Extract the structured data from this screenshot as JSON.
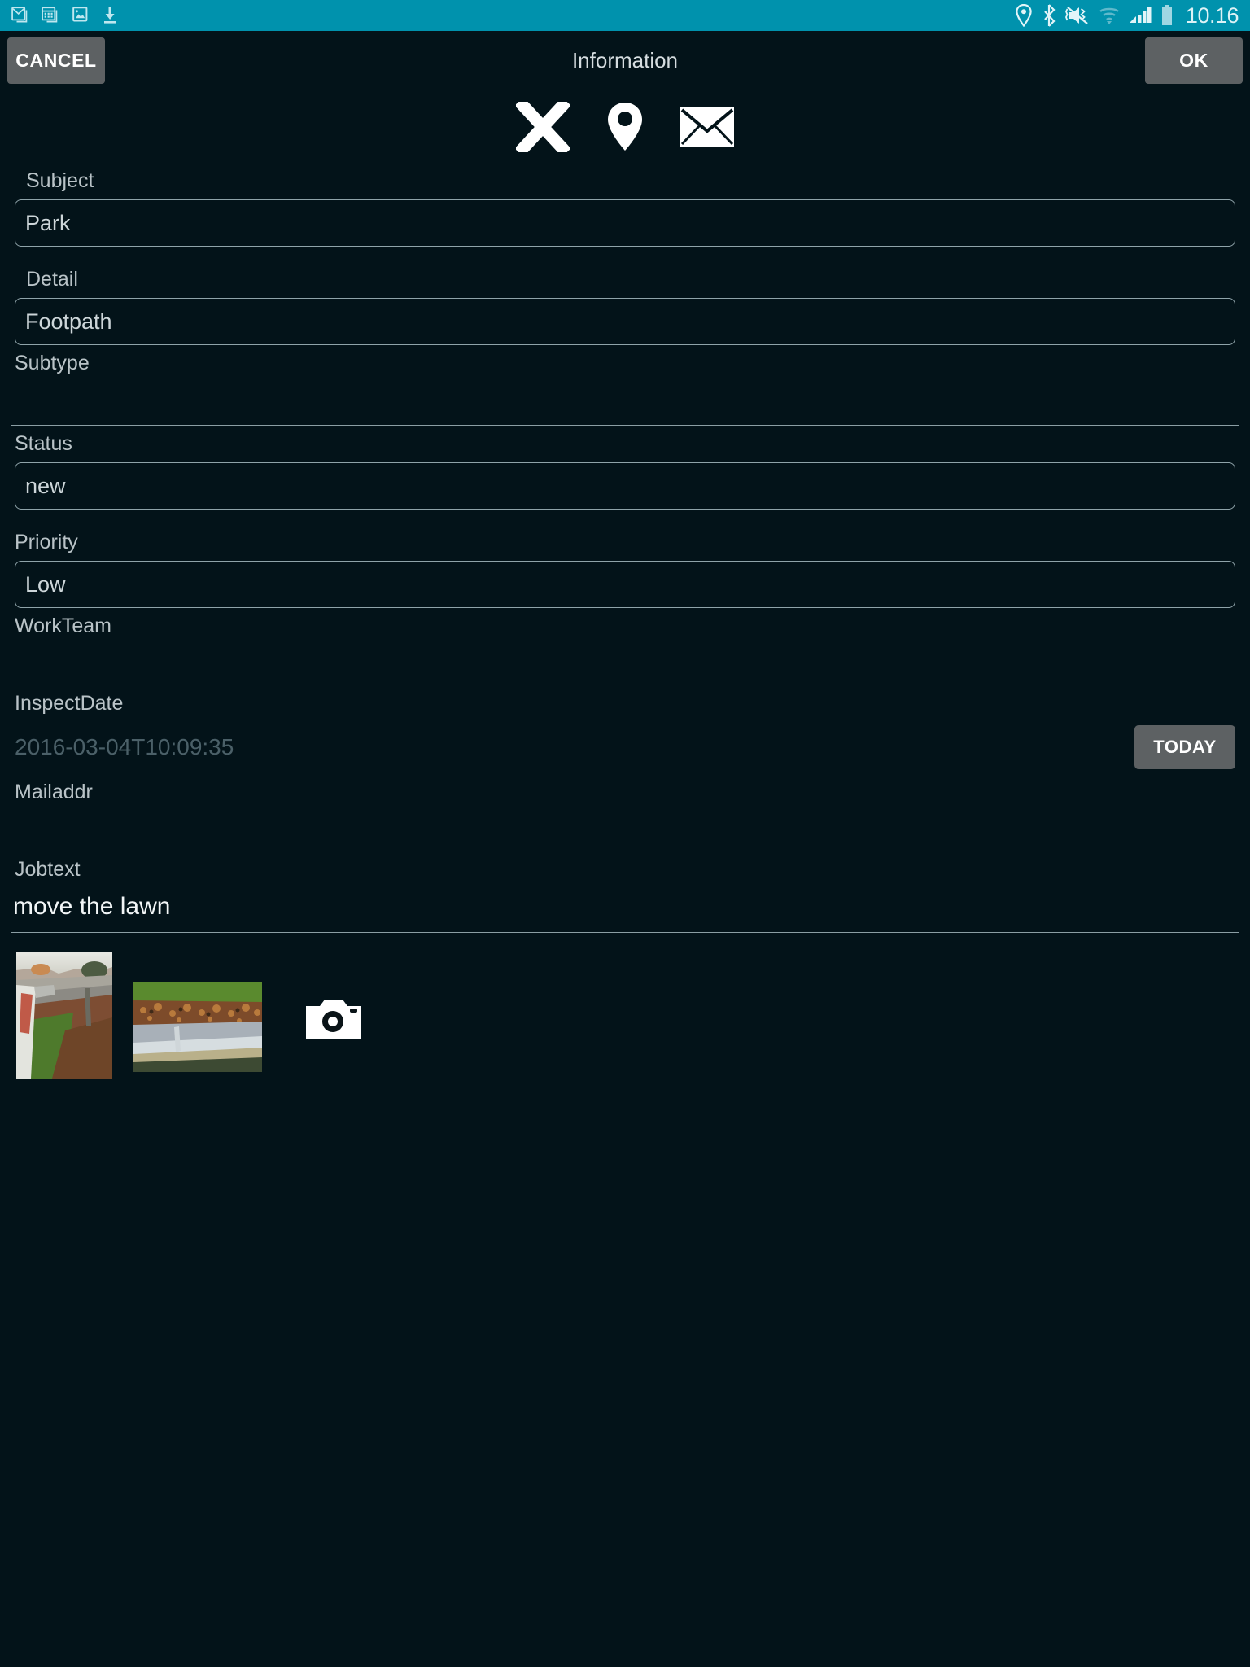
{
  "statusbar": {
    "time": "10.16",
    "left_icons": [
      "gmail-icon",
      "calendar-icon",
      "gallery-icon",
      "download-icon"
    ],
    "right_icons": [
      "location-icon",
      "bluetooth-icon",
      "mute-vibrate-icon",
      "wifi-icon",
      "signal-icon",
      "battery-icon"
    ],
    "background_color": "#0092ad"
  },
  "header": {
    "cancel_label": "CANCEL",
    "title": "Information",
    "ok_label": "OK"
  },
  "action_icons": [
    {
      "name": "close-icon",
      "label": "X"
    },
    {
      "name": "location-pin-icon",
      "label": "Location"
    },
    {
      "name": "mail-icon",
      "label": "Mail"
    }
  ],
  "form": {
    "subject": {
      "label": "Subject",
      "value": "Park"
    },
    "detail": {
      "label": "Detail",
      "value": "Footpath"
    },
    "subtype": {
      "label": "Subtype",
      "value": ""
    },
    "status": {
      "label": "Status",
      "value": "new"
    },
    "priority": {
      "label": "Priority",
      "value": "Low"
    },
    "workteam": {
      "label": "WorkTeam",
      "value": ""
    },
    "inspectdate": {
      "label": "InspectDate",
      "value": "2016-03-04T10:09:35",
      "button_label": "TODAY"
    },
    "mailaddr": {
      "label": "Mailaddr",
      "value": ""
    },
    "jobtext": {
      "label": "Jobtext",
      "value": "move the lawn"
    }
  },
  "attachments": {
    "photos": [
      {
        "name": "photo-thumbnail-1",
        "alt": "Street with green lawn and houses"
      },
      {
        "name": "photo-thumbnail-2",
        "alt": "Path alongside hedge and grass"
      }
    ],
    "camera_button": "camera-icon"
  },
  "colors": {
    "accent": "#0092ad",
    "background": "#031319",
    "button": "#5d6163",
    "label_text": "#b9c3c7",
    "value_text": "#cdd6d9",
    "placeholder_text": "#4b6068",
    "divider": "#8b9ea4"
  }
}
